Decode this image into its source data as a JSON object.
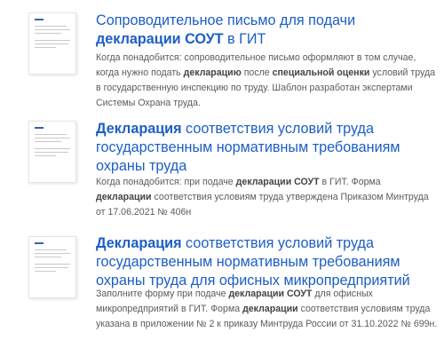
{
  "results": [
    {
      "title": [
        {
          "t": "Сопроводительное письмо для подачи ",
          "b": false
        },
        {
          "t": "декларации",
          "b": true
        },
        {
          "t": " ",
          "b": false
        },
        {
          "t": "СОУТ",
          "b": true
        },
        {
          "t": " в ГИТ",
          "b": false
        }
      ],
      "desc": [
        {
          "t": "Когда понадобится: сопроводительное письмо оформляют в том случае, когда нужно подать ",
          "b": false
        },
        {
          "t": "декларацию",
          "b": true
        },
        {
          "t": " после ",
          "b": false
        },
        {
          "t": "специальной оценки",
          "b": true
        },
        {
          "t": " условий труда в государственную инспекцию по труду. Шаблон разработан экспертами Системы Охрана труда.",
          "b": false
        }
      ]
    },
    {
      "title": [
        {
          "t": "Декларация",
          "b": true
        },
        {
          "t": " соответствия условий труда государственным нормативным требованиям охраны труда",
          "b": false
        }
      ],
      "desc": [
        {
          "t": "Когда понадобится: при подаче ",
          "b": false
        },
        {
          "t": "декларации",
          "b": true
        },
        {
          "t": " ",
          "b": false
        },
        {
          "t": "СОУТ",
          "b": true
        },
        {
          "t": " в ГИТ. Форма ",
          "b": false
        },
        {
          "t": "декларации",
          "b": true
        },
        {
          "t": " соответствия условиям труда утверждена Приказом Минтруда  от 17.06.2021 № 406н",
          "b": false
        }
      ]
    },
    {
      "title": [
        {
          "t": "Декларация",
          "b": true
        },
        {
          "t": " соответствия условий труда государственным нормативным требованиям охраны труда для офисных микропредприятий",
          "b": false
        }
      ],
      "desc": [
        {
          "t": "Заполните форму при подаче ",
          "b": false
        },
        {
          "t": "декларации",
          "b": true
        },
        {
          "t": " ",
          "b": false
        },
        {
          "t": "СОУТ",
          "b": true
        },
        {
          "t": " для офисных микропредприятий в ГИТ. Форма ",
          "b": false
        },
        {
          "t": "декларации",
          "b": true
        },
        {
          "t": " соответствия условиям труда указана в приложении № 2 к приказу Минтруда России от 31.10.2022 № 699н.",
          "b": false
        }
      ]
    }
  ],
  "thumb_icon": "document-thumbnail-icon",
  "colors": {
    "link": "#1c5ec6",
    "text": "#5b5b5b"
  }
}
